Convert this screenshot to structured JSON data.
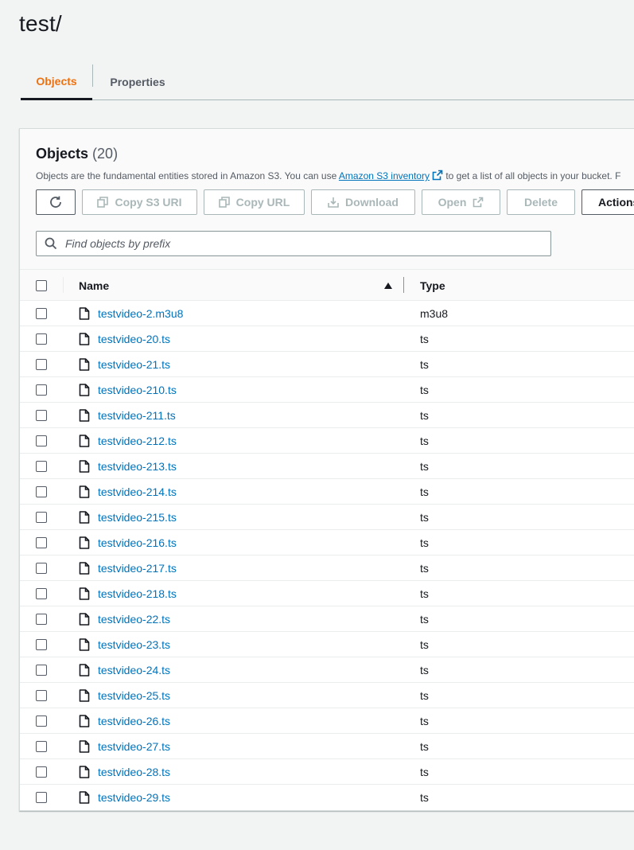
{
  "page": {
    "title": "test/"
  },
  "tabs": [
    {
      "label": "Objects",
      "active": true
    },
    {
      "label": "Properties",
      "active": false
    }
  ],
  "objects_panel": {
    "title": "Objects",
    "count": "(20)",
    "description_prefix": "Objects are the fundamental entities stored in Amazon S3. You can use ",
    "inventory_link": "Amazon S3 inventory",
    "description_suffix": " to get a list of all objects in your bucket. F",
    "toolbar": {
      "refresh_icon": "refresh-icon",
      "copy_s3_uri": "Copy S3 URI",
      "copy_url": "Copy URL",
      "download": "Download",
      "open": "Open",
      "delete": "Delete",
      "actions": "Actions"
    },
    "search": {
      "placeholder": "Find objects by prefix",
      "value": ""
    },
    "columns": {
      "name": "Name",
      "type": "Type",
      "sort": "ascending"
    },
    "rows": [
      {
        "name": "testvideo-2.m3u8",
        "type": "m3u8"
      },
      {
        "name": "testvideo-20.ts",
        "type": "ts"
      },
      {
        "name": "testvideo-21.ts",
        "type": "ts"
      },
      {
        "name": "testvideo-210.ts",
        "type": "ts"
      },
      {
        "name": "testvideo-211.ts",
        "type": "ts"
      },
      {
        "name": "testvideo-212.ts",
        "type": "ts"
      },
      {
        "name": "testvideo-213.ts",
        "type": "ts"
      },
      {
        "name": "testvideo-214.ts",
        "type": "ts"
      },
      {
        "name": "testvideo-215.ts",
        "type": "ts"
      },
      {
        "name": "testvideo-216.ts",
        "type": "ts"
      },
      {
        "name": "testvideo-217.ts",
        "type": "ts"
      },
      {
        "name": "testvideo-218.ts",
        "type": "ts"
      },
      {
        "name": "testvideo-22.ts",
        "type": "ts"
      },
      {
        "name": "testvideo-23.ts",
        "type": "ts"
      },
      {
        "name": "testvideo-24.ts",
        "type": "ts"
      },
      {
        "name": "testvideo-25.ts",
        "type": "ts"
      },
      {
        "name": "testvideo-26.ts",
        "type": "ts"
      },
      {
        "name": "testvideo-27.ts",
        "type": "ts"
      },
      {
        "name": "testvideo-28.ts",
        "type": "ts"
      },
      {
        "name": "testvideo-29.ts",
        "type": "ts"
      }
    ]
  },
  "colors": {
    "accent": "#ec7211",
    "link": "#0073bb",
    "text": "#16191f",
    "muted": "#545b64",
    "disabled": "#aab7b8"
  }
}
